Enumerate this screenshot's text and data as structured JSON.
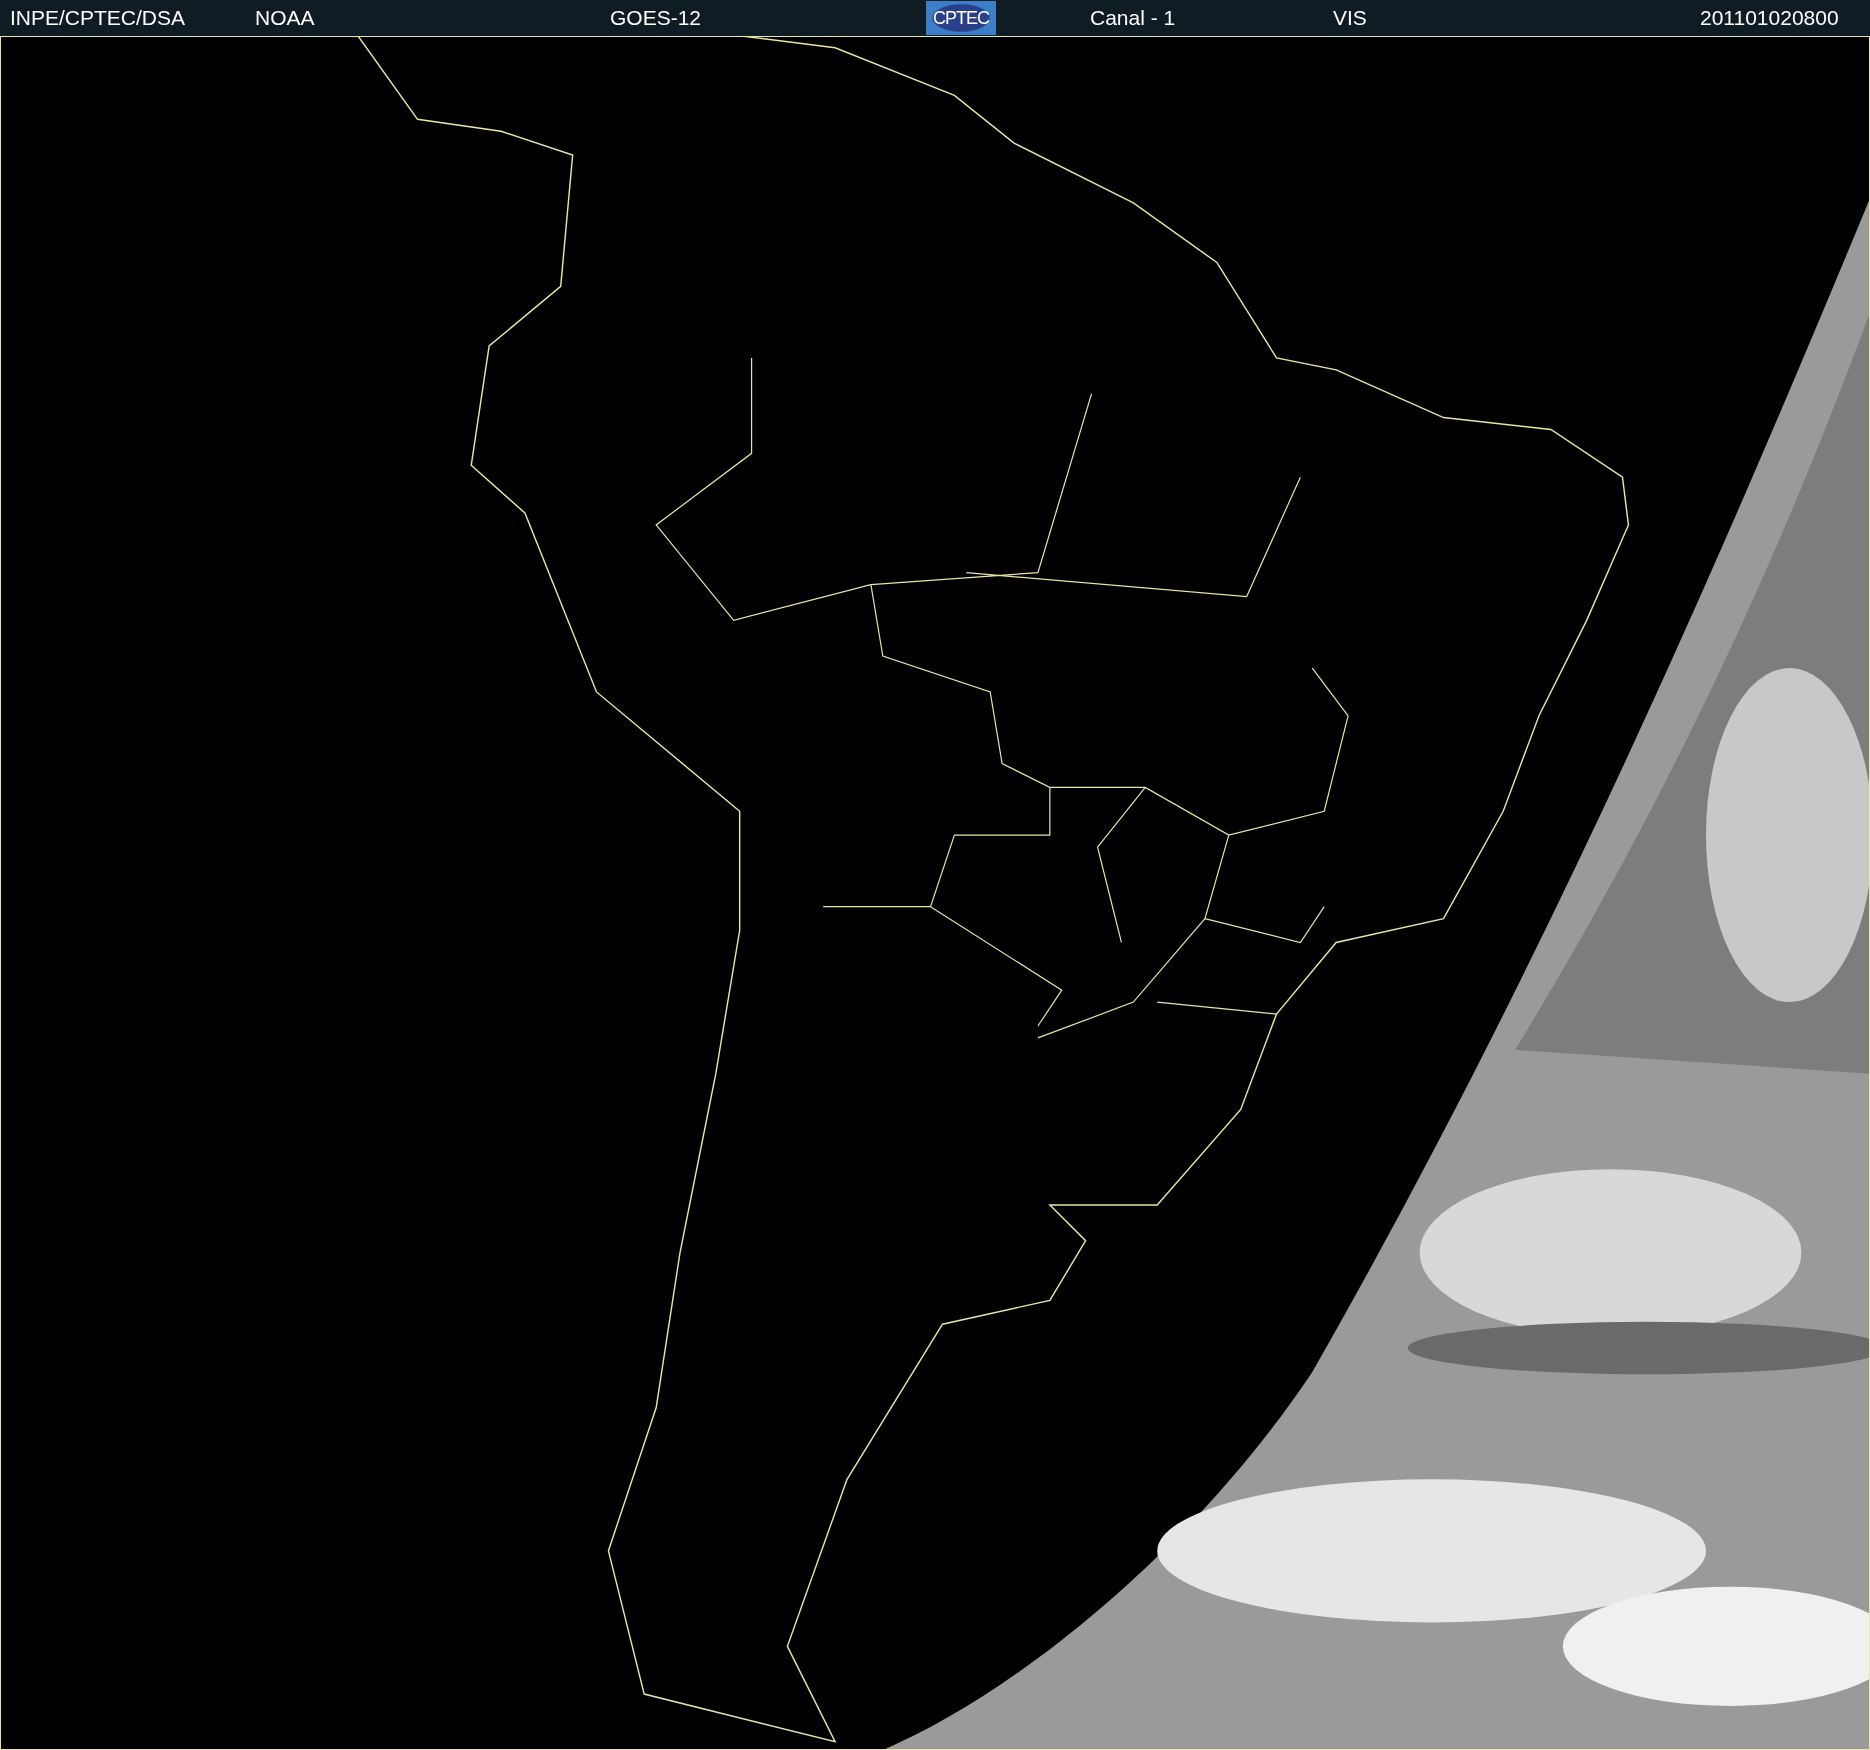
{
  "header": {
    "items": [
      {
        "kind": "text",
        "text": "INPE/CPTEC/DSA"
      },
      {
        "kind": "text",
        "text": "NOAA"
      },
      {
        "kind": "text",
        "text": "GOES-12"
      },
      {
        "kind": "logo",
        "text": "CPTEC"
      },
      {
        "kind": "text",
        "text": "Canal - 1"
      },
      {
        "kind": "text",
        "text": "VIS"
      },
      {
        "kind": "text",
        "text": "201101020800"
      }
    ]
  }
}
